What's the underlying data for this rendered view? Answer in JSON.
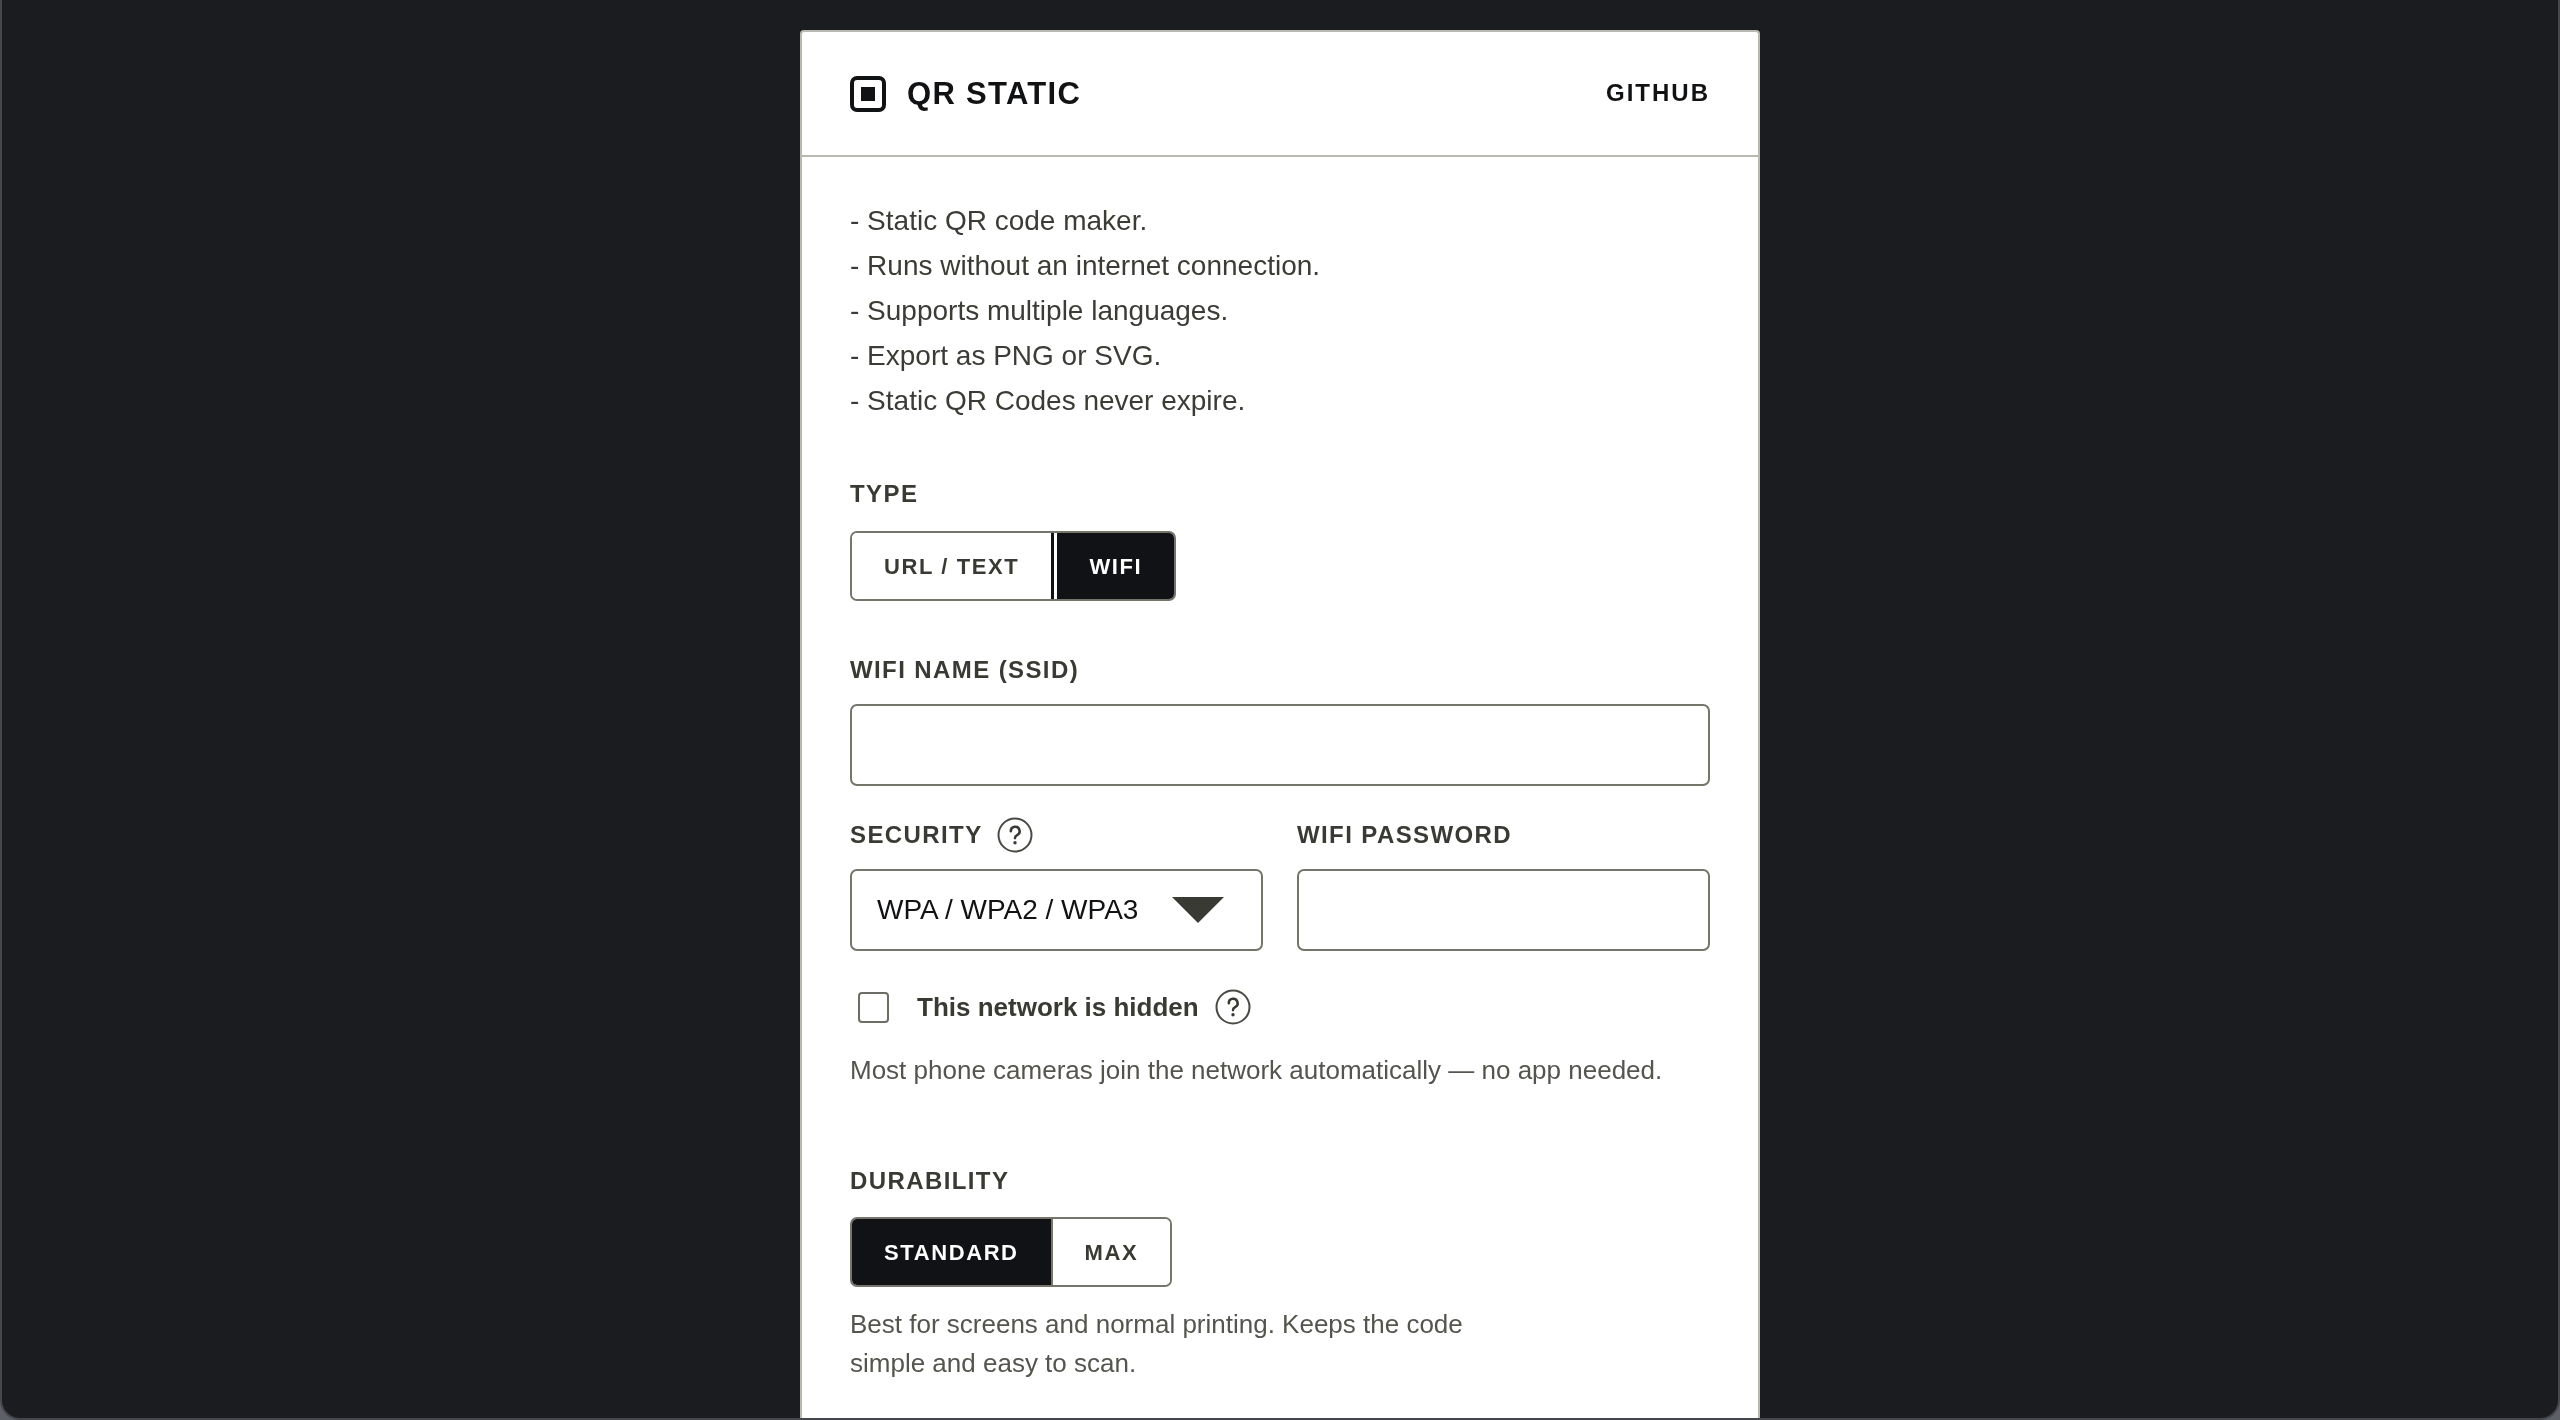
{
  "header": {
    "title": "QR STATIC",
    "link": "GITHUB"
  },
  "features": [
    "- Static QR code maker.",
    "- Runs without an internet connection.",
    "- Supports multiple languages.",
    "- Export as PNG or SVG.",
    "- Static QR Codes never expire."
  ],
  "type": {
    "label": "TYPE",
    "options": [
      {
        "label": "URL / TEXT",
        "selected": false
      },
      {
        "label": "WIFI",
        "selected": true
      }
    ]
  },
  "wifi_name": {
    "label": "WIFI NAME (SSID)"
  },
  "security": {
    "label": "SECURITY",
    "value": "WPA / WPA2 / WPA3"
  },
  "password": {
    "label": "WIFI PASSWORD"
  },
  "hidden_network": {
    "label": "This network is hidden",
    "checked": false
  },
  "hint": "Most phone cameras join the network automatically — no app needed.",
  "durability": {
    "label": "DURABILITY",
    "options": [
      {
        "label": "STANDARD",
        "selected": true
      },
      {
        "label": "MAX",
        "selected": false
      }
    ],
    "description": "Best for screens and normal printing. Keeps the code simple and easy to scan."
  }
}
